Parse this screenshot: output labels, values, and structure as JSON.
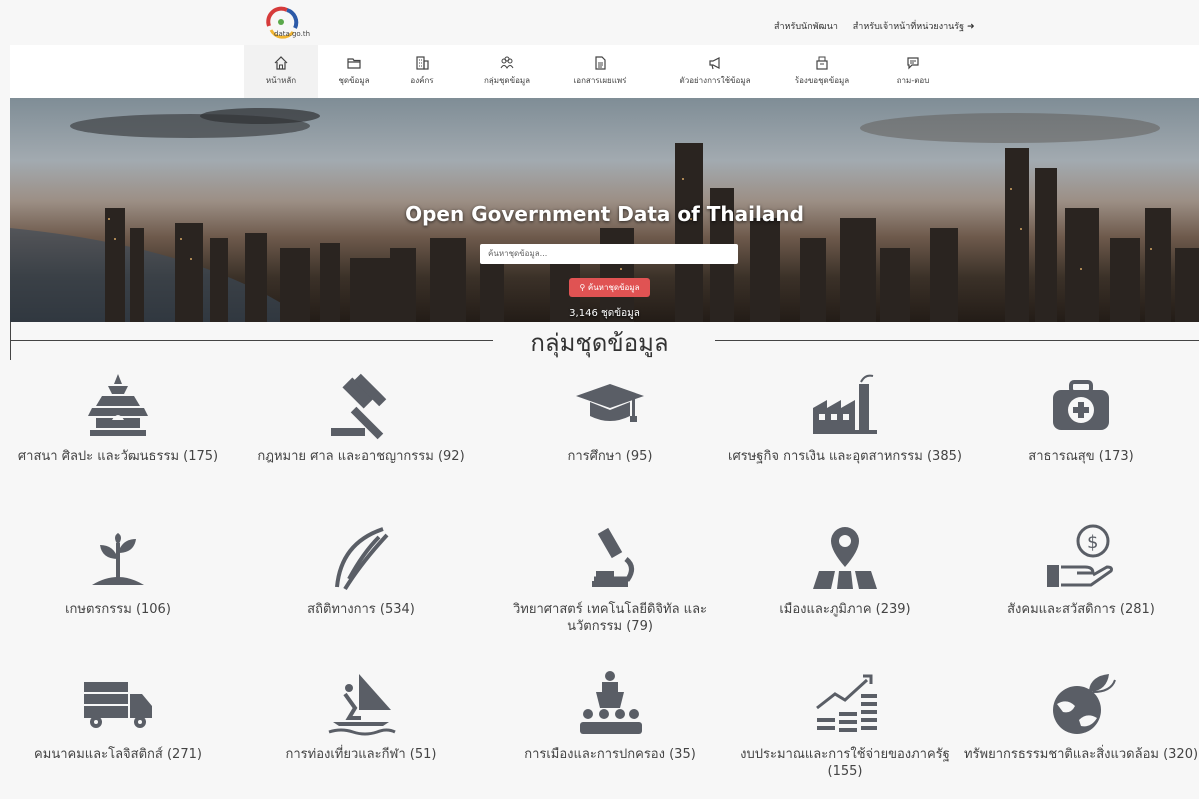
{
  "brand": {
    "logo_text": "data.go.th"
  },
  "top_links": [
    "สำหรับนักพัฒนา",
    "สำหรับเจ้าหน้าที่หน่วยงานรัฐ"
  ],
  "nav": [
    {
      "label": "หน้าหลัก",
      "icon": "home-icon"
    },
    {
      "label": "ชุดข้อมูล",
      "icon": "folder-icon"
    },
    {
      "label": "องค์กร",
      "icon": "building-icon"
    },
    {
      "label": "กลุ่มชุดข้อมูล",
      "icon": "group-icon"
    },
    {
      "label": "เอกสารเผยแพร่",
      "icon": "document-icon"
    },
    {
      "label": "ตัวอย่างการใช้ข้อมูล",
      "icon": "megaphone-icon"
    },
    {
      "label": "ร้องขอชุดข้อมูล",
      "icon": "request-icon"
    },
    {
      "label": "ถาม-ตอบ",
      "icon": "chat-icon"
    }
  ],
  "hero": {
    "title": "Open Government Data of Thailand",
    "search_placeholder": "ค้นหาชุดข้อมูล...",
    "search_button": "ค้นหาชุดข้อมูล",
    "dataset_count": "3,146 ชุดข้อมูล"
  },
  "section_title": "กลุ่มชุดข้อมูล",
  "categories": [
    {
      "label": "ศาสนา ศิลปะ และวัฒนธรรม (175)",
      "icon": "temple-icon"
    },
    {
      "label": "กฎหมาย ศาล และอาชญากรรม (92)",
      "icon": "gavel-icon"
    },
    {
      "label": "การศึกษา (95)",
      "icon": "graduation-cap-icon"
    },
    {
      "label": "เศรษฐกิจ การเงิน และอุตสาหกรรม (385)",
      "icon": "factory-icon"
    },
    {
      "label": "สาธารณสุข (173)",
      "icon": "medical-kit-icon"
    },
    {
      "label": "เกษตรกรรม (106)",
      "icon": "sprout-icon"
    },
    {
      "label": "สถิติทางการ (534)",
      "icon": "statistics-icon"
    },
    {
      "label": "วิทยาศาสตร์ เทคโนโลยีดิจิทัล และนวัตกรรม (79)",
      "icon": "microscope-icon"
    },
    {
      "label": "เมืองและภูมิภาค (239)",
      "icon": "map-pin-icon"
    },
    {
      "label": "สังคมและสวัสดิการ (281)",
      "icon": "money-hand-icon"
    },
    {
      "label": "คมนาคมและโลจิสติกส์ (271)",
      "icon": "truck-icon"
    },
    {
      "label": "การท่องเที่ยวและกีฬา (51)",
      "icon": "windsurf-icon"
    },
    {
      "label": "การเมืองและการปกครอง (35)",
      "icon": "podium-icon"
    },
    {
      "label": "งบประมาณและการใช้จ่ายของภาครัฐ (155)",
      "icon": "budget-chart-icon"
    },
    {
      "label": "ทรัพยากรธรรมชาติและสิ่งแวดล้อม (320)",
      "icon": "earth-plant-icon"
    }
  ],
  "colors": {
    "icon_gray": "#5a5e66",
    "accent_red": "#e05353",
    "nav_bg": "#ffffff"
  }
}
